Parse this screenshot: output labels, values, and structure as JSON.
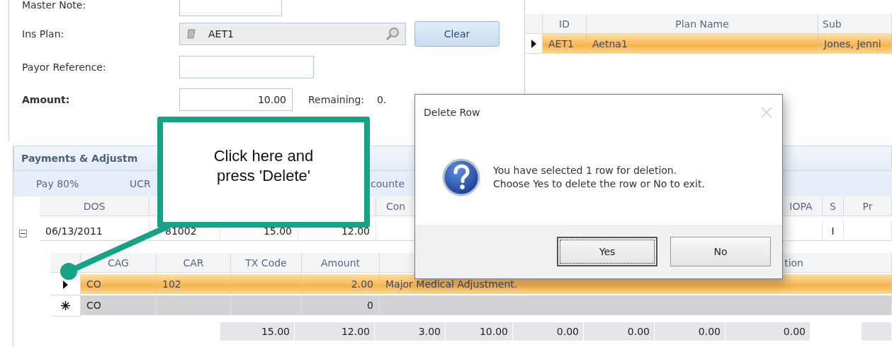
{
  "form": {
    "master_note": {
      "label": "Master Note:"
    },
    "ins_plan": {
      "label": "Ins Plan:",
      "value": "AET1",
      "button": "Clear"
    },
    "payor_reference": {
      "label": "Payor Reference:"
    },
    "amount": {
      "label": "Amount:",
      "value": "10.00",
      "remaining_label": "Remaining:",
      "remaining_value": "0."
    }
  },
  "plan_grid": {
    "columns": [
      "ID",
      "Plan Name",
      "Sub"
    ],
    "rows": [
      {
        "selected": true,
        "cells": [
          "AET1",
          "Aetna1",
          "Jones, Jenni"
        ]
      }
    ]
  },
  "payments": {
    "title": "Payments & Adjustm",
    "toolbar": [
      "Pay 80%",
      "UCR",
      "counte"
    ],
    "grid": {
      "columns": [
        "DOS",
        null,
        null,
        null,
        "Con",
        null,
        "IOPA",
        "S",
        "Pr"
      ],
      "rows": [
        {
          "expanded": true,
          "cells": [
            "06/13/2011",
            "81002",
            "15.00",
            "12.00",
            null,
            null,
            null,
            "I",
            null
          ]
        }
      ]
    },
    "child_grid": {
      "columns": [
        "CAG",
        "CAR",
        "TX Code",
        "Amount",
        "tion"
      ],
      "rows": [
        {
          "kind": "record",
          "selected": true,
          "cells": [
            "CO",
            "102",
            null,
            "2.00",
            "Major Medical Adjustment."
          ]
        },
        {
          "kind": "new",
          "selected": false,
          "cells": [
            "CO",
            null,
            null,
            "0",
            null
          ]
        }
      ]
    },
    "totals": [
      "15.00",
      "12.00",
      "3.00",
      "10.00",
      "0.00",
      "0.00",
      "0.00",
      "0.00"
    ]
  },
  "dialog": {
    "title": "Delete Row",
    "message_lines": [
      "You have selected 1 row for deletion.",
      "Choose Yes to delete the row or No to exit."
    ],
    "buttons": [
      {
        "label": "Yes",
        "focused": true
      },
      {
        "label": "No",
        "focused": false
      }
    ]
  },
  "callout": {
    "lines": [
      "Click here and",
      "press 'Delete'"
    ]
  }
}
